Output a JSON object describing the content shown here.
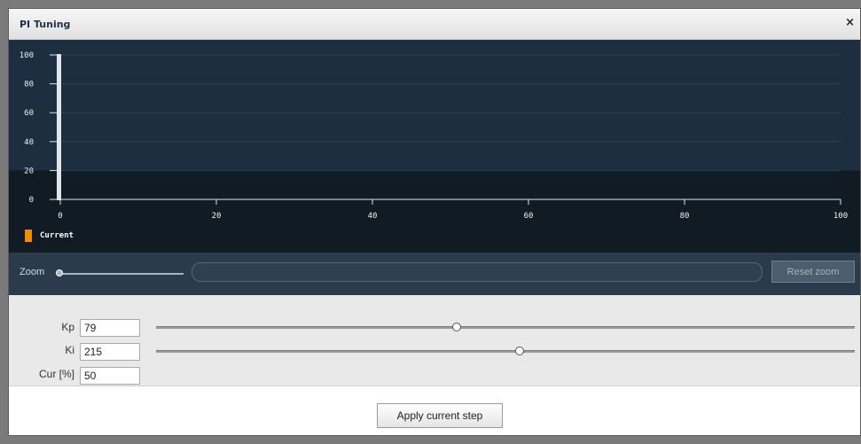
{
  "dialog": {
    "title": "PI Tuning",
    "close_icon": "close-icon",
    "close_glyph": "×"
  },
  "chart_data": {
    "type": "line",
    "title": "",
    "xlabel": "",
    "ylabel": "",
    "xlim": [
      0,
      100
    ],
    "ylim": [
      0,
      100
    ],
    "x_ticks": [
      0,
      20,
      40,
      60,
      80,
      100
    ],
    "y_ticks": [
      0,
      20,
      40,
      60,
      80,
      100
    ],
    "grid": true,
    "series": [
      {
        "name": "Current",
        "color": "#f08c00",
        "x": [],
        "y": []
      }
    ],
    "legend_position": "bottom-left"
  },
  "zoom": {
    "label": "Zoom",
    "value": 0,
    "reset_label": "Reset zoom"
  },
  "params": [
    {
      "label": "Kp",
      "value": "79",
      "slider": 0.43
    },
    {
      "label": "Ki",
      "value": "215",
      "slider": 0.52
    },
    {
      "label": "Cur [%]",
      "value": "50",
      "slider": null
    }
  ],
  "apply_label": "Apply current step",
  "colors": {
    "chart_background": "#101b24",
    "plot_band": "#1c2e40",
    "series": "#f08c00"
  }
}
